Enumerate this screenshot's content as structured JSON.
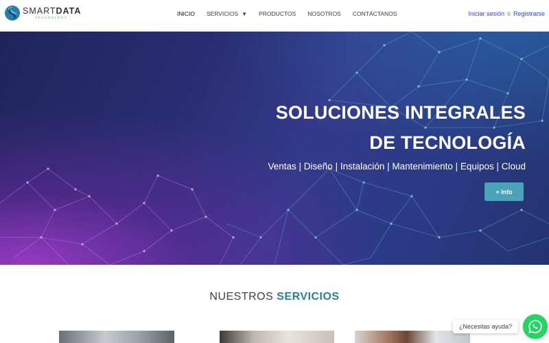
{
  "brand": {
    "name_light": "SMART",
    "name_bold": "DATA",
    "tagline": "TECHNOLOGY"
  },
  "nav": {
    "items": [
      {
        "label": "INICIO"
      },
      {
        "label": "SERVICIOS"
      },
      {
        "label": "PRODUCTOS"
      },
      {
        "label": "NOSOTROS"
      },
      {
        "label": "CONTÁCTANOS"
      }
    ]
  },
  "auth": {
    "login": "Iniciar sesión",
    "or": "ó",
    "register": "Registrarse"
  },
  "hero": {
    "title_line1": "SOLUCIONES INTEGRALES",
    "title_line2": "DE TECNOLOGÍA",
    "subtitle": "Ventas | Diseño | Instalación | Mantenimiento | Equipos | Cloud",
    "button": "+ Info"
  },
  "services": {
    "title_prefix": "NUESTROS",
    "title_accent": "SERVICIOS"
  },
  "chat": {
    "bubble": "¿Necesitas ayuda?"
  },
  "colors": {
    "accent": "#4aa3b8",
    "link": "#3a46b8",
    "whatsapp": "#25d366"
  },
  "icons": {
    "logo": "swirl-logo-icon",
    "dropdown": "chevron-down-icon",
    "whatsapp": "whatsapp-icon"
  }
}
